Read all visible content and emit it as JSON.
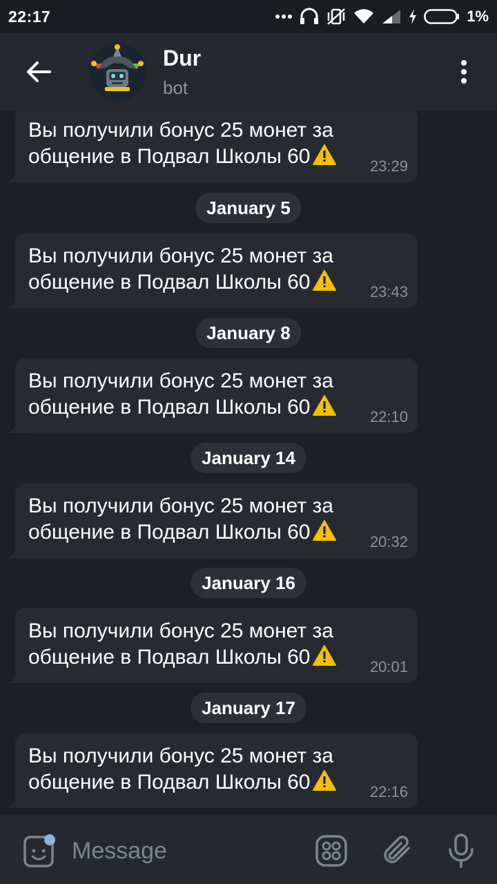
{
  "status_bar": {
    "time": "22:17",
    "battery_percent": "1%"
  },
  "header": {
    "title": "Dur",
    "subtitle": "bot"
  },
  "messages": [
    {
      "text": "Вы получили бонус 25 монет за общение в Подвал Школы 60",
      "emoji": "warning-emoji",
      "time": "23:29"
    },
    {
      "date": "January 5",
      "text": "Вы получили бонус 25 монет за общение в Подвал Школы 60",
      "emoji": "warning-emoji",
      "time": "23:43"
    },
    {
      "date": "January 8",
      "text": "Вы получили бонус 25 монет за общение в Подвал Школы 60",
      "emoji": "warning-emoji",
      "time": "22:10"
    },
    {
      "date": "January 14",
      "text": "Вы получили бонус 25 монет за общение в Подвал Школы 60",
      "emoji": "warning-emoji",
      "time": "20:32"
    },
    {
      "date": "January 16",
      "text": "Вы получили бонус 25 монет за общение в Подвал Школы 60",
      "emoji": "warning-emoji",
      "time": "20:01"
    },
    {
      "date": "January 17",
      "text": "Вы получили бонус 25 монет за общение в Подвал Школы 60",
      "emoji": "warning-emoji",
      "time": "22:16"
    }
  ],
  "input": {
    "placeholder": "Message"
  },
  "colors": {
    "background": "#1d2024",
    "header": "#25292f",
    "bubble": "#272b31",
    "date_chip": "#2c3137",
    "muted_text": "#8a96a3",
    "warning": "#f5c000"
  }
}
